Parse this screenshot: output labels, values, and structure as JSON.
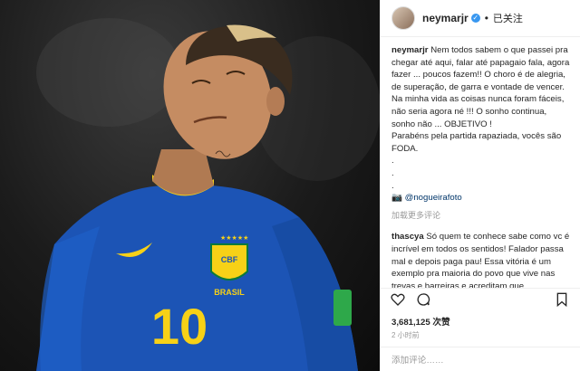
{
  "post": {
    "username": "neymarjr",
    "verified_symbol": "✓",
    "separator": "•",
    "follow_label": "已关注",
    "caption_user": "neymarjr",
    "caption_lines": [
      "Nem todos sabem o que passei pra chegar até aqui, falar até papagaio fala, agora fazer ... poucos fazem!! O choro é de alegria, de superação, de garra e vontade de vencer.",
      "Na minha vida as coisas nunca foram fáceis, não seria agora né !!! O sonho continua, sonho não ... OBJETIVO !",
      "Parabéns pela partida rapaziada, vocês são FODA.",
      ".",
      ".",
      "."
    ],
    "photo_credit": "📷 @nogueirafoto",
    "load_more": "加载更多评论",
    "comment_user": "thascya",
    "comment_text": "Só quem te conhece sabe como vc é incrível em todos os sentidos! Falador passa mal e depois paga pau! Essa vitória é um exemplo pra maioria do povo que vive nas trevas e barreiras e acreditam que",
    "likes": "3,681,125 次赞",
    "time": "2 小时前",
    "add_comment_placeholder": "添加评论……"
  },
  "jersey": {
    "brand_text": "BRASIL",
    "number": "10"
  },
  "icons": {
    "like": "heart-icon",
    "comment": "comment-icon",
    "save": "bookmark-icon",
    "more": "more-icon"
  },
  "colors": {
    "jersey_blue": "#1c54b5",
    "jersey_yellow": "#f7d117",
    "text": "#262626",
    "muted": "#999999",
    "link": "#003569"
  }
}
